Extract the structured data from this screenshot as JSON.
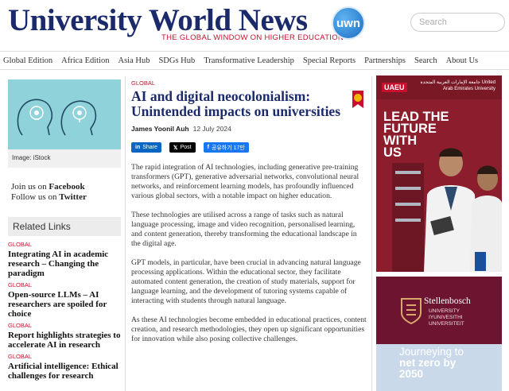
{
  "header": {
    "brand": "University World News",
    "tagline": "THE GLOBAL WINDOW ON HIGHER EDUCATION",
    "logo_text": "uwn",
    "search_placeholder": "Search"
  },
  "nav": {
    "items": [
      "Global Edition",
      "Africa Edition",
      "Asia Hub",
      "SDGs Hub",
      "Transformative Leadership",
      "Special Reports",
      "Partnerships",
      "Search",
      "About Us"
    ]
  },
  "left": {
    "image_caption": "Image: iStock",
    "follow_facebook_prefix": "Join us on ",
    "follow_facebook": "Facebook",
    "follow_twitter_prefix": "Follow us on ",
    "follow_twitter": "Twitter",
    "related_heading": "Related Links",
    "related": [
      {
        "tag": "GLOBAL",
        "title": "Integrating AI in academic research – Changing the paradigm"
      },
      {
        "tag": "GLOBAL",
        "title": "Open-source LLMs – AI researchers are spoiled for choice"
      },
      {
        "tag": "GLOBAL",
        "title": "Report highlights strategies to accelerate AI in research"
      },
      {
        "tag": "GLOBAL",
        "title": "Artificial intelligence: Ethical challenges for research"
      }
    ]
  },
  "article": {
    "tag": "GLOBAL",
    "headline": "AI and digital neocolonialism: Unintended impacts on universities",
    "author": "James Yoonil Auh",
    "date": "12 July 2024",
    "share_linkedin": "Share",
    "share_x": "Post",
    "share_facebook": "공유하기 17만",
    "paragraphs": [
      "The rapid integration of AI technologies, including generative pre-training transformers (GPT), generative adversarial networks, convolutional neural networks, and reinforcement learning models, has profoundly influenced various global sectors, with a notable impact on higher education.",
      "These technologies are utilised across a range of tasks such as natural language processing, image and video recognition, personalised learning, and content generation, thereby transforming the educational landscape in the digital age.",
      "GPT models, in particular, have been crucial in advancing natural language processing applications. Within the educational sector, they facilitate automated content generation, the creation of study materials, support for language learning, and the development of tutoring systems capable of interacting with students through natural language.",
      "As these AI technologies become embedded in educational practices, content creation, and research methodologies, they open up significant opportunities for innovation while also posing collective challenges."
    ]
  },
  "ads": {
    "uaeu_badge": "UAEU",
    "uaeu_name": "جامعة الإمارات العربية المتحدة United Arab Emirates University",
    "uaeu_headline": "LEAD THE\nFUTURE\nWITH\nUS",
    "stellenbosch_name": "Stellenbosch",
    "stellenbosch_sub": "UNIVERSITY\nIYUNIVESITHI\nUNIVERSITEIT",
    "stellenbosch_line1": "Journeying to",
    "stellenbosch_line2": "net zero by",
    "stellenbosch_line3": "2050"
  }
}
